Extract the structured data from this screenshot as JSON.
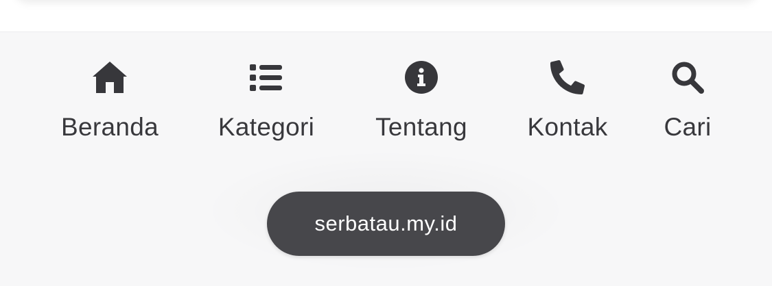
{
  "nav": {
    "items": [
      {
        "id": "home",
        "label": "Beranda",
        "icon": "home-icon"
      },
      {
        "id": "category",
        "label": "Kategori",
        "icon": "list-icon"
      },
      {
        "id": "about",
        "label": "Tentang",
        "icon": "info-icon"
      },
      {
        "id": "contact",
        "label": "Kontak",
        "icon": "phone-icon"
      },
      {
        "id": "search",
        "label": "Cari",
        "icon": "search-icon"
      }
    ]
  },
  "footer": {
    "domain": "serbatau.my.id"
  },
  "colors": {
    "bar_background": "#f7f7f8",
    "icon_text": "#37373b",
    "pill_background": "#47474b",
    "pill_text": "#ffffff"
  }
}
